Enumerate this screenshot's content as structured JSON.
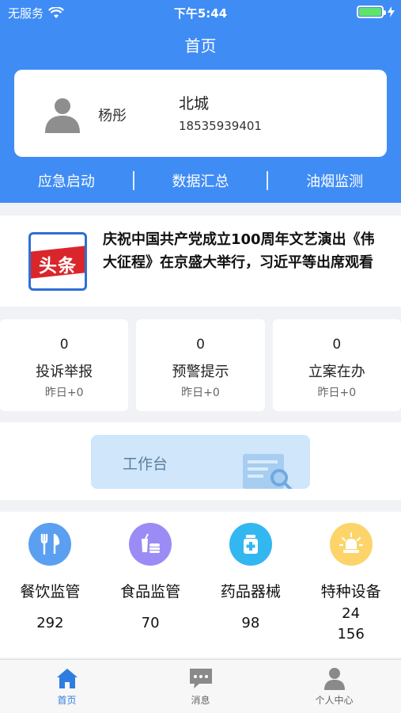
{
  "status_bar": {
    "carrier": "无服务",
    "time": "下午5:44"
  },
  "header": {
    "title": "首页"
  },
  "user": {
    "name": "杨彤",
    "org": "北城",
    "phone": "18535939401"
  },
  "quick_nav": [
    "应急启动",
    "数据汇总",
    "油烟监测"
  ],
  "news": {
    "badge": "头条",
    "text": "庆祝中国共产党成立100周年文艺演出《伟大征程》在京盛大举行，习近平等出席观看"
  },
  "stats": [
    {
      "count": "0",
      "label": "投诉举报",
      "sub": "昨日+0"
    },
    {
      "count": "0",
      "label": "预警提示",
      "sub": "昨日+0"
    },
    {
      "count": "0",
      "label": "立案在办",
      "sub": "昨日+0"
    }
  ],
  "workbench": {
    "label": "工作台"
  },
  "categories": [
    {
      "name": "餐饮监管",
      "value": "292",
      "icon": "utensils-icon",
      "color": "#5b9ff0"
    },
    {
      "name": "食品监管",
      "value": "70",
      "icon": "food-icon",
      "color": "#9b8cf5"
    },
    {
      "name": "药品器械",
      "value": "98",
      "icon": "medicine-icon",
      "color": "#33b7f0"
    },
    {
      "name": "特种设备",
      "value": "24\n156",
      "icon": "alarm-light-icon",
      "color": "#fcd46a"
    }
  ],
  "tabbar": [
    {
      "label": "首页",
      "icon": "home-icon",
      "active": true
    },
    {
      "label": "消息",
      "icon": "message-icon",
      "active": false
    },
    {
      "label": "个人中心",
      "icon": "person-icon",
      "active": false
    }
  ],
  "colors": {
    "primary": "#3f8cf5",
    "tab_active": "#2f7de1"
  }
}
